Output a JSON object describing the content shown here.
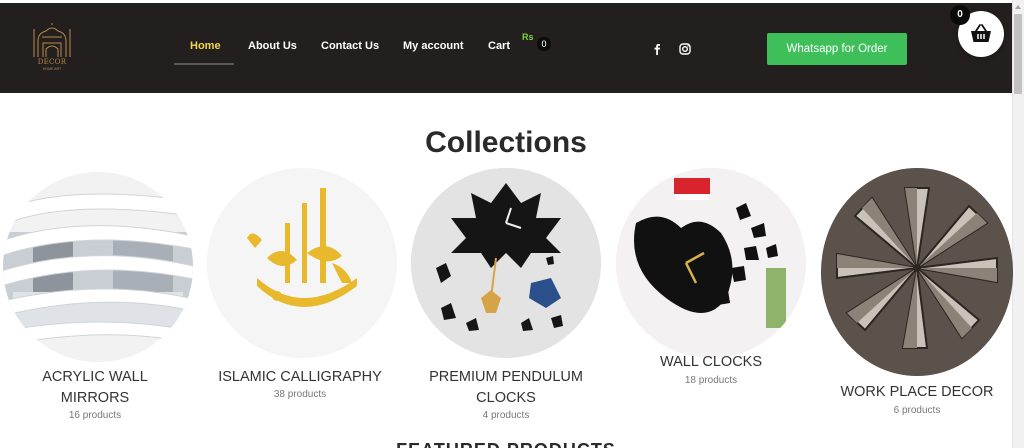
{
  "brand": {
    "logo_text": "DECOR",
    "logo_sub": "HOME ART"
  },
  "nav": {
    "items": [
      {
        "label": "Home",
        "active": true
      },
      {
        "label": "About Us"
      },
      {
        "label": "Contact Us"
      },
      {
        "label": "My account"
      },
      {
        "label": "Cart"
      }
    ],
    "cart_currency": "Rs",
    "cart_count": "0"
  },
  "social": [
    "facebook-icon",
    "instagram-icon"
  ],
  "whatsapp_button": "Whatsapp for Order",
  "basket": {
    "count": "0"
  },
  "collections": {
    "title": "Collections",
    "items": [
      {
        "title_line1": "ACRYLIC WALL",
        "title_line2": "MIRRORS",
        "count": "16 products"
      },
      {
        "title_line1": "ISLAMIC CALLIGRAPHY",
        "title_line2": "",
        "count": "38 products"
      },
      {
        "title_line1": "PREMIUM PENDULUM",
        "title_line2": "CLOCKS",
        "count": "4 products"
      },
      {
        "title_line1": "WALL CLOCKS",
        "title_line2": "",
        "count": "18 products"
      },
      {
        "title_line1": "WORK PLACE DECOR",
        "title_line2": "",
        "count": "6 products"
      }
    ]
  },
  "featured_title": "FEATURED PRODUCTS",
  "colors": {
    "header_bg": "#231f1e",
    "nav_active": "#f3d64a",
    "whatsapp": "#3fbf5a",
    "currency": "#7fd13b"
  }
}
